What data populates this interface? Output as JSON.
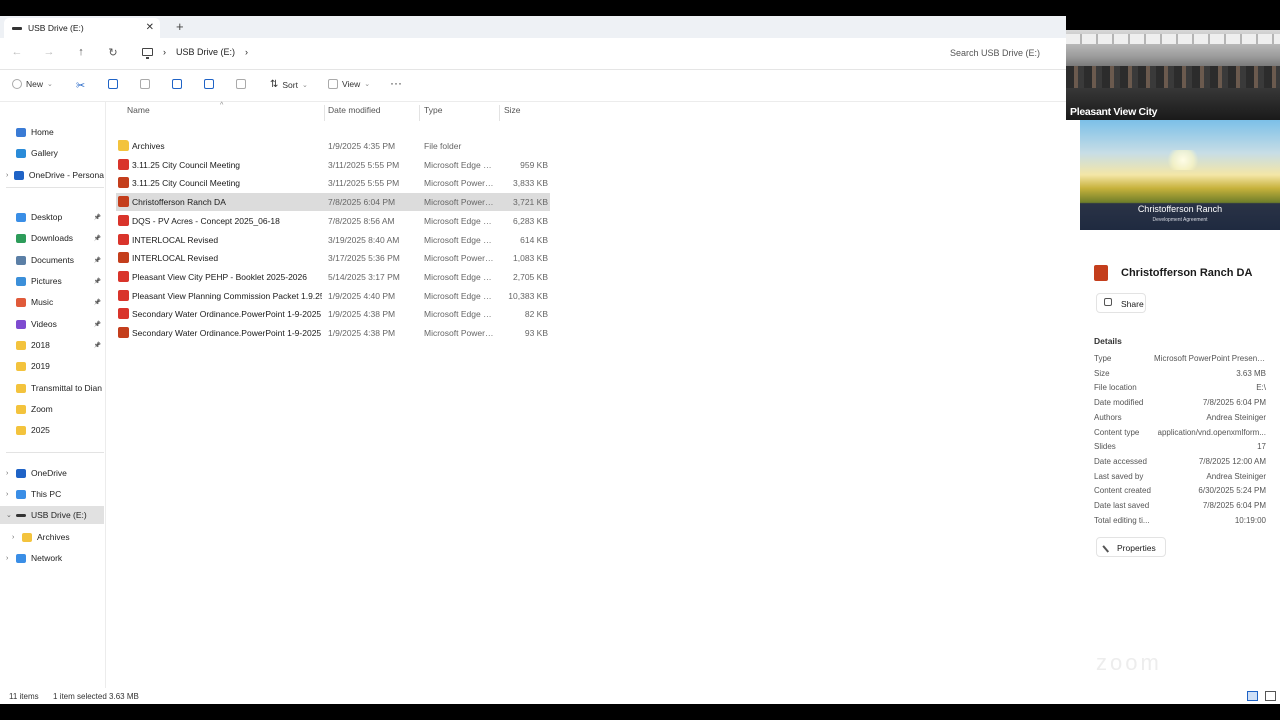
{
  "window": {
    "tab_title": "USB Drive (E:)",
    "tab_close": "✕",
    "new_tab": "+"
  },
  "address_bar": {
    "breadcrumb": [
      "USB Drive (E:)"
    ],
    "search_placeholder": "Search USB Drive (E:)"
  },
  "toolbar": {
    "new_label": "New",
    "sort_label": "Sort",
    "view_label": "View",
    "more_label": "···"
  },
  "nav": {
    "quick_access": [
      {
        "label": "Home",
        "icon": "home-icon",
        "color": "#3a7bd5",
        "pinned": false
      },
      {
        "label": "Gallery",
        "icon": "gallery-icon",
        "color": "#2a8bd8",
        "pinned": false
      },
      {
        "label": "OneDrive - Persona",
        "icon": "cloud-icon",
        "color": "#1f63c6",
        "pinned": false
      },
      {
        "label": "Desktop",
        "icon": "desktop-icon",
        "color": "#3a8ee6",
        "pinned": true
      },
      {
        "label": "Downloads",
        "icon": "download-icon",
        "color": "#2d9c5a",
        "pinned": true
      },
      {
        "label": "Documents",
        "icon": "documents-icon",
        "color": "#5b7fa6",
        "pinned": true
      },
      {
        "label": "Pictures",
        "icon": "pictures-icon",
        "color": "#3b8fd9",
        "pinned": true
      },
      {
        "label": "Music",
        "icon": "music-icon",
        "color": "#e05a3a",
        "pinned": true
      },
      {
        "label": "Videos",
        "icon": "videos-icon",
        "color": "#7e4bd0",
        "pinned": true
      },
      {
        "label": "2018",
        "icon": "folder-icon",
        "color": "#f3c33d",
        "pinned": true
      },
      {
        "label": "2019",
        "icon": "folder-icon",
        "color": "#f3c33d",
        "pinned": false
      },
      {
        "label": "Transmittal to Dian",
        "icon": "folder-icon",
        "color": "#f3c33d",
        "pinned": false
      },
      {
        "label": "Zoom",
        "icon": "folder-icon",
        "color": "#f3c33d",
        "pinned": false
      },
      {
        "label": "2025",
        "icon": "folder-icon",
        "color": "#f3c33d",
        "pinned": false
      }
    ],
    "tree": [
      {
        "label": "OneDrive",
        "icon": "cloud-icon",
        "color": "#1f63c6"
      },
      {
        "label": "This PC",
        "icon": "pc-icon",
        "color": "#3a8ee6"
      },
      {
        "label": "USB Drive (E:)",
        "icon": "drive-icon",
        "color": "#333333"
      },
      {
        "label": "Archives",
        "icon": "folder-icon",
        "color": "#f3c33d"
      },
      {
        "label": "Network",
        "icon": "network-icon",
        "color": "#3a8ee6"
      }
    ]
  },
  "columns": {
    "name": "Name",
    "date": "Date modified",
    "type": "Type",
    "size": "Size"
  },
  "files": [
    {
      "name": "Archives",
      "date": "1/9/2025 4:35 PM",
      "type": "File folder",
      "size": "",
      "kind": "folder"
    },
    {
      "name": "3.11.25 City Council Meeting",
      "date": "3/11/2025 5:55 PM",
      "type": "Microsoft Edge P...",
      "size": "959 KB",
      "kind": "pdf"
    },
    {
      "name": "3.11.25 City Council Meeting",
      "date": "3/11/2025 5:55 PM",
      "type": "Microsoft PowerP...",
      "size": "3,833 KB",
      "kind": "ppt"
    },
    {
      "name": "Christofferson Ranch DA",
      "date": "7/8/2025 6:04 PM",
      "type": "Microsoft PowerP...",
      "size": "3,721 KB",
      "kind": "ppt"
    },
    {
      "name": "DQS - PV Acres - Concept 2025_06-18",
      "date": "7/8/2025 8:56 AM",
      "type": "Microsoft Edge P...",
      "size": "6,283 KB",
      "kind": "pdf"
    },
    {
      "name": "INTERLOCAL Revised",
      "date": "3/19/2025 8:40 AM",
      "type": "Microsoft Edge P...",
      "size": "614 KB",
      "kind": "pdf"
    },
    {
      "name": "INTERLOCAL Revised",
      "date": "3/17/2025 5:36 PM",
      "type": "Microsoft PowerP...",
      "size": "1,083 KB",
      "kind": "ppt"
    },
    {
      "name": "Pleasant View City PEHP - Booklet 2025-2026",
      "date": "5/14/2025 3:17 PM",
      "type": "Microsoft Edge P...",
      "size": "2,705 KB",
      "kind": "pdf"
    },
    {
      "name": "Pleasant View Planning Commission Packet 1.9.25",
      "date": "1/9/2025 4:40 PM",
      "type": "Microsoft Edge P...",
      "size": "10,383 KB",
      "kind": "pdf"
    },
    {
      "name": "Secondary Water Ordinance.PowerPoint 1-9-2025",
      "date": "1/9/2025 4:38 PM",
      "type": "Microsoft Edge P...",
      "size": "82 KB",
      "kind": "pdf"
    },
    {
      "name": "Secondary Water Ordinance.PowerPoint 1-9-2025",
      "date": "1/9/2025 4:38 PM",
      "type": "Microsoft PowerP...",
      "size": "93 KB",
      "kind": "ppt"
    }
  ],
  "selected_index": 3,
  "details_pane": {
    "title": "Christofferson Ranch DA",
    "share_label": "Share",
    "section_label": "Details",
    "properties_label": "Properties",
    "watermark": "zoom",
    "rows": [
      {
        "k": "Type",
        "v": "Microsoft PowerPoint Present..."
      },
      {
        "k": "Size",
        "v": "3.63 MB"
      },
      {
        "k": "File location",
        "v": "E:\\"
      },
      {
        "k": "Date modified",
        "v": "7/8/2025 6:04 PM"
      },
      {
        "k": "Authors",
        "v": "Andrea Steiniger"
      },
      {
        "k": "Content type",
        "v": "application/vnd.openxmlform..."
      },
      {
        "k": "Slides",
        "v": "17"
      },
      {
        "k": "Date accessed",
        "v": "7/8/2025 12:00 AM"
      },
      {
        "k": "Last saved by",
        "v": "Andrea Steiniger"
      },
      {
        "k": "Content created",
        "v": "6/30/2025 5:24 PM"
      },
      {
        "k": "Date last saved",
        "v": "7/8/2025 6:04 PM"
      },
      {
        "k": "Total editing ti...",
        "v": "10:19:00"
      }
    ]
  },
  "video": {
    "camera_label": "Pleasant View City",
    "slide_title": "Christofferson Ranch",
    "slide_subtitle": "Development Agreement"
  },
  "status": {
    "items": "11 items",
    "selection": "1 item selected  3.63 MB"
  }
}
